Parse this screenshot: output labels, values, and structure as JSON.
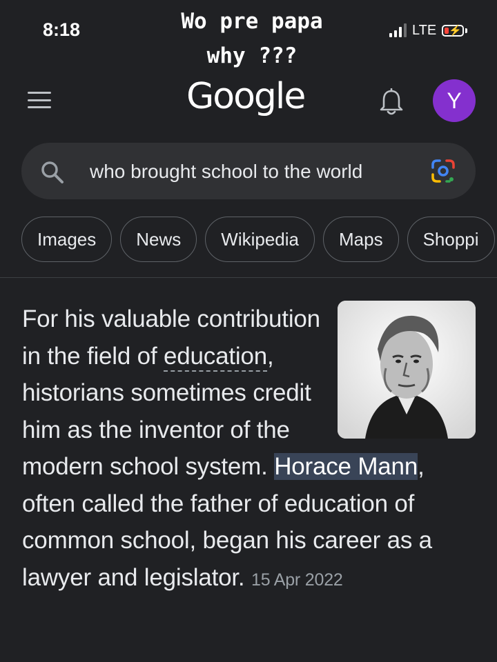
{
  "status_bar": {
    "time": "8:18",
    "network": "LTE",
    "battery_level": 0.25,
    "battery_color": "#ff453a"
  },
  "overlay_caption": "Wo pre papa\nwhy ???",
  "header": {
    "logo": "Google",
    "avatar_letter": "Y",
    "avatar_color": "#8430ce",
    "menu_icon": "hamburger-icon",
    "bell_icon": "bell-icon"
  },
  "search": {
    "query": "who brought school to the world",
    "search_icon": "search-icon",
    "lens_icon": "google-lens-icon"
  },
  "chips": [
    "Images",
    "News",
    "Wikipedia",
    "Maps",
    "Shoppi"
  ],
  "snippet": {
    "part1": "For his valuable contribution in the field of ",
    "link": "education",
    "part2": ", historians sometimes credit him as the inventor of the modern school system. ",
    "highlight": "Horace Mann",
    "part3": ", often called the father of education of common school, began his career as a lawyer and legislator.",
    "date": "15 Apr 2022",
    "highlight_color": "#394457"
  }
}
